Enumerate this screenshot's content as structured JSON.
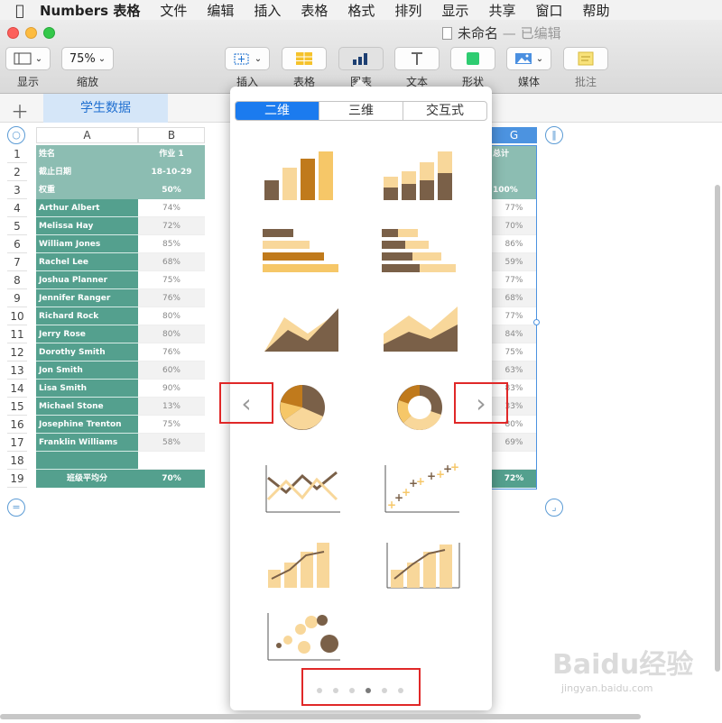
{
  "menubar": {
    "app": "Numbers 表格",
    "items": [
      "文件",
      "编辑",
      "插入",
      "表格",
      "格式",
      "排列",
      "显示",
      "共享",
      "窗口",
      "帮助"
    ]
  },
  "window": {
    "title": "未命名",
    "edited": "— 已编辑"
  },
  "toolbar": {
    "display_label": "显示",
    "zoom_value": "75%",
    "zoom_label": "缩放",
    "insert_label": "插入",
    "table_label": "表格",
    "chart_label": "图表",
    "text_label": "文本",
    "shape_label": "形状",
    "media_label": "媒体",
    "comment_label": "批注"
  },
  "sheet": {
    "tab": "学生数据"
  },
  "table": {
    "columns": [
      "A",
      "B",
      "G"
    ],
    "header_rows": [
      {
        "a": "姓名",
        "b": "作业 1",
        "g": "总计"
      },
      {
        "a": "截止日期",
        "b": "18-10-29",
        "g": ""
      },
      {
        "a": "权重",
        "b": "50%",
        "g": "100%"
      }
    ],
    "rows": [
      {
        "name": "Arthur Albert",
        "b": "74%",
        "g": "77%"
      },
      {
        "name": "Melissa Hay",
        "b": "72%",
        "g": "70%"
      },
      {
        "name": "William Jones",
        "b": "85%",
        "g": "86%"
      },
      {
        "name": "Rachel Lee",
        "b": "68%",
        "g": "59%"
      },
      {
        "name": "Joshua Planner",
        "b": "75%",
        "g": "77%"
      },
      {
        "name": "Jennifer Ranger",
        "b": "76%",
        "g": "68%"
      },
      {
        "name": "Richard Rock",
        "b": "80%",
        "g": "77%"
      },
      {
        "name": "Jerry Rose",
        "b": "80%",
        "g": "84%"
      },
      {
        "name": "Dorothy Smith",
        "b": "76%",
        "g": "75%"
      },
      {
        "name": "Jon Smith",
        "b": "60%",
        "g": "63%"
      },
      {
        "name": "Lisa Smith",
        "b": "90%",
        "g": "83%"
      },
      {
        "name": "Michael Stone",
        "b": "13%",
        "g": "33%"
      },
      {
        "name": "Josephine Trenton",
        "b": "75%",
        "g": "80%"
      },
      {
        "name": "Franklin Williams",
        "b": "58%",
        "g": "69%"
      }
    ],
    "footer": {
      "a": "班级平均分",
      "b": "70%",
      "g": "72%"
    },
    "row_numbers": [
      "1",
      "2",
      "3",
      "4",
      "5",
      "6",
      "7",
      "8",
      "9",
      "10",
      "11",
      "12",
      "13",
      "14",
      "15",
      "16",
      "17",
      "18",
      "19"
    ]
  },
  "chart_popover": {
    "tabs": [
      "二维",
      "三维",
      "交互式"
    ],
    "active_tab": "二维",
    "page_count": 6,
    "active_page": 4
  },
  "watermark": {
    "text": "Baidu经验",
    "sub": "jingyan.baidu.com"
  },
  "colors": {
    "accent": "#1b7bef",
    "teal": "#54a08e",
    "header": "#8cbdb2",
    "brown": "#7a6048",
    "orange": "#f3b43c",
    "cream": "#f8d79a"
  }
}
